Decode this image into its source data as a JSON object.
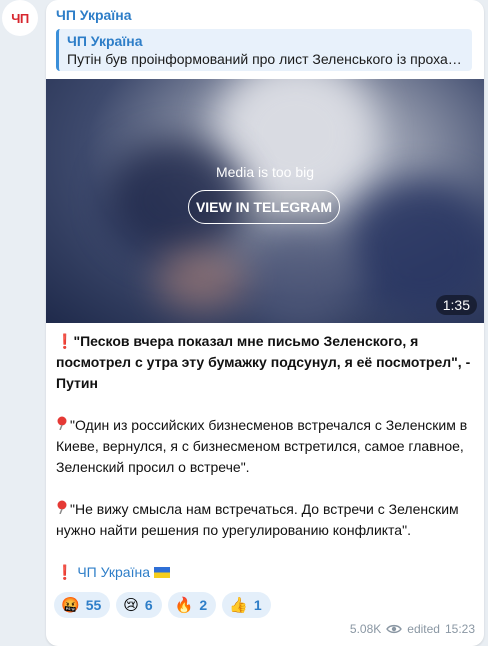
{
  "avatar": {
    "text": "ЧП"
  },
  "post": {
    "channel_name": "ЧП Україна",
    "reply": {
      "title": "ЧП Україна",
      "text": "Путін був проінформований про лист Зеленського із прохан…"
    },
    "media": {
      "label": "Media is too big",
      "button": "VIEW IN TELEGRAM",
      "duration": "1:35"
    },
    "text": {
      "para1": "\"Песков вчера показал мне письмо Зеленского, я посмотрел с утра эту бумажку подсунул, я её посмотрел\", - Путин",
      "para2": "\"Один из российских бизнесменов встречался с Зеленским в Киеве, вернулся, я с бизнесменом встретился, самое главное, Зеленский просил о встрече\".",
      "para3": "\"Не вижу смысла нам встречаться. До встречи с Зеленским нужно найти решения по урегулированию конфликта\".",
      "signature": "ЧП Україна",
      "signature_flag": "🇺🇦"
    },
    "reactions": [
      {
        "emoji": "🤬",
        "count": "55"
      },
      {
        "emoji": "😢",
        "count": "6"
      },
      {
        "emoji": "🔥",
        "count": "2"
      },
      {
        "emoji": "👍",
        "count": "1"
      }
    ],
    "footer": {
      "views": "5.08K",
      "edited": "edited",
      "time": "15:23"
    }
  },
  "colors": {
    "accent": "#2e7ec8",
    "bubble": "#ffffff",
    "background": "#e9eef3",
    "reaction_bg": "#e4effa"
  }
}
